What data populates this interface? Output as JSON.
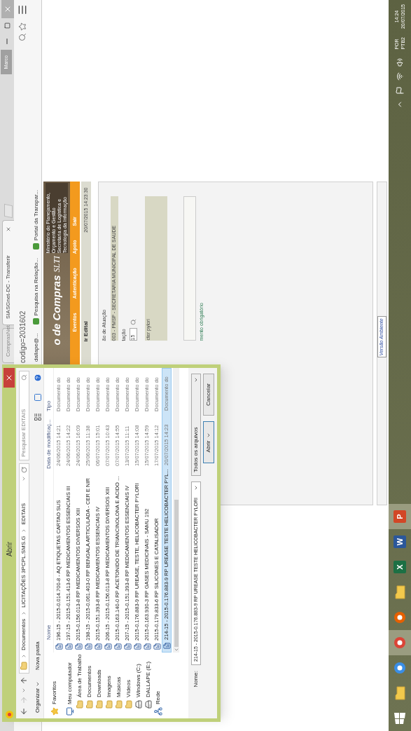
{
  "browser": {
    "tabs": [
      {
        "label": "ComprasNet",
        "selected": false
      },
      {
        "label": "SIASGnet-DC - Transferir",
        "selected": true
      }
    ],
    "profile": "Marco",
    "address": "codigo=2031602",
    "bookmarks": [
      {
        "label": "dallape@..."
      },
      {
        "label": "Pesquisa na Relação..."
      },
      {
        "label": "Portal da Transpar..."
      }
    ]
  },
  "page": {
    "banner_title": "o de Compras",
    "ministry": "Ministério do Planejamento, Orçamento e Gestão",
    "logo": "SLTI",
    "secretariat": "Secretaria de Logística e Tecnologia da Informação",
    "menu": [
      "Eventos",
      "Autenticação",
      "Apoio",
      "Sair"
    ],
    "heading": "ir Edital",
    "timestamp": "20/07/2015 14:23:30",
    "fields": [
      {
        "kind": "label",
        "text": "ão de Atuação"
      },
      {
        "kind": "bar",
        "text": "003 - PMSP - SECRETARIA MUNICIPAL DE SAUDE"
      },
      {
        "kind": "label",
        "text": "tação"
      },
      {
        "kind": "search",
        "value": "15"
      },
      {
        "kind": "textarea",
        "label": "cter pylori"
      },
      {
        "kind": "input"
      },
      {
        "kind": "note",
        "text": "mento obrigatório"
      }
    ],
    "footer_logo": "Versão Ambiente"
  },
  "dialog": {
    "title": "Abrir",
    "path": [
      "Documentos",
      "LICITAÇÕES 3PCPL.SMS.G",
      "EDITAIS"
    ],
    "search": {
      "placeholder": "Pesquisar EDITAIS"
    },
    "toolbar": [
      "Organizar",
      "Nova pasta"
    ],
    "nav": [
      {
        "kind": "star",
        "label": "Favoritos"
      },
      {
        "kind": "computer",
        "label": "Meu computador",
        "children": [
          {
            "kind": "folder",
            "label": "Área de Trabalho"
          },
          {
            "kind": "folder",
            "label": "Documentos"
          },
          {
            "kind": "folder",
            "label": "Downloads"
          },
          {
            "kind": "folder",
            "label": "Imagens"
          },
          {
            "kind": "folder",
            "label": "Músicas"
          },
          {
            "kind": "folder",
            "label": "Vídeos"
          },
          {
            "kind": "drive",
            "label": "Windows (C:)"
          },
          {
            "kind": "drive",
            "label": "DALLAPE (E:)"
          }
        ]
      },
      {
        "kind": "network",
        "label": "Rede"
      }
    ],
    "columns": [
      "Nome",
      "Data de modificaç...",
      "Tipo"
    ],
    "rows": [
      {
        "name": "196-15 - 2015-0.014.700-8 - AQ ETIQUETAS CARTAO SUS",
        "date": "24/06/2015 14:21",
        "type": "Documento do",
        "selected": false
      },
      {
        "name": "197-15 - 2015-0.151.413-6 RP MEDICAMENTOS ESSENCIAIS III",
        "date": "24/06/2015 14:22",
        "type": "Documento do",
        "selected": false
      },
      {
        "name": "2015-0.156.013-8 RP MEDICAMENTOS DIVERSOS XIII",
        "date": "24/06/2015 16:09",
        "type": "Documento do",
        "selected": false
      },
      {
        "name": "198-15 - 2015-0.061.403-0 RP BENGALA ARTICULADA - CER E NIR",
        "date": "25/06/2015 11:38",
        "type": "Documento do",
        "selected": false
      },
      {
        "name": "2015-0.151.393-8 RP MEDICAMENTOS ESSENCIAIS IV",
        "date": "06/07/2015 15:01",
        "type": "Documento do",
        "selected": false
      },
      {
        "name": "206-15 - 2015-0.156.013-8 RP MEDICAMENTOS DIVERSOS XIII",
        "date": "07/07/2015 10:43",
        "type": "Documento do",
        "selected": false
      },
      {
        "name": "2015-0.163.140-0 RP ACETONIDO DE TRIANCINOLONA E ACIDO ...",
        "date": "07/07/2015 14:55",
        "type": "Documento do",
        "selected": false
      },
      {
        "name": "207-15 - 2015-0.151.393-8 RP MEDICAMENTOS ESSENCIAIS IV",
        "date": "13/07/2015 11:11",
        "type": "Documento do",
        "selected": false
      },
      {
        "name": "2015-0.176.883-9 RP UREASE, TESTE, HELICOBACTER PYLORI",
        "date": "15/07/2015 14:08",
        "type": "Documento do",
        "selected": false
      },
      {
        "name": "2015-0.163.930-3 RP GASES MEDICINAIS - SAMU 192",
        "date": "15/07/2015 14:59",
        "type": "Documento do",
        "selected": false
      },
      {
        "name": "2015-0.179.833-6 RP SILICONES E CATALISADOR",
        "date": "17/07/2015 14:12",
        "type": "Documento do",
        "selected": false
      },
      {
        "name": "214-15 - 2015-0.176.883-9 RP UREASE TESTE HELICOBACTER PYL...",
        "date": "20/07/2015 14:23",
        "type": "Documento do",
        "selected": true
      }
    ],
    "file_name_label": "Nome:",
    "file_name": "214-15 - 2015-0.176.883-9 RP UREASE TESTE HELICOBACTER PYLORI",
    "file_type": "Todos os arquivos",
    "buttons": [
      "Abrir",
      "Cancelar"
    ]
  },
  "taskbar": {
    "apps": [
      {
        "kind": "start",
        "open": false
      },
      {
        "kind": "folder",
        "open": false
      },
      {
        "kind": "globe",
        "color": "#3a8ee6",
        "open": false
      },
      {
        "kind": "globe",
        "color": "#db4437",
        "open": true
      },
      {
        "kind": "globe",
        "color": "#e66000",
        "open": false
      },
      {
        "kind": "folder",
        "open": false
      },
      {
        "kind": "tile",
        "color": "#1d7044",
        "letter": "X",
        "open": false
      },
      {
        "kind": "tile",
        "color": "#2b579a",
        "letter": "W",
        "open": false
      },
      {
        "kind": "tile",
        "color": "#d24726",
        "letter": "P",
        "open": true
      }
    ],
    "language": [
      "POR",
      "PTB2"
    ],
    "clock": [
      "14:24",
      "20/07/2015"
    ]
  }
}
